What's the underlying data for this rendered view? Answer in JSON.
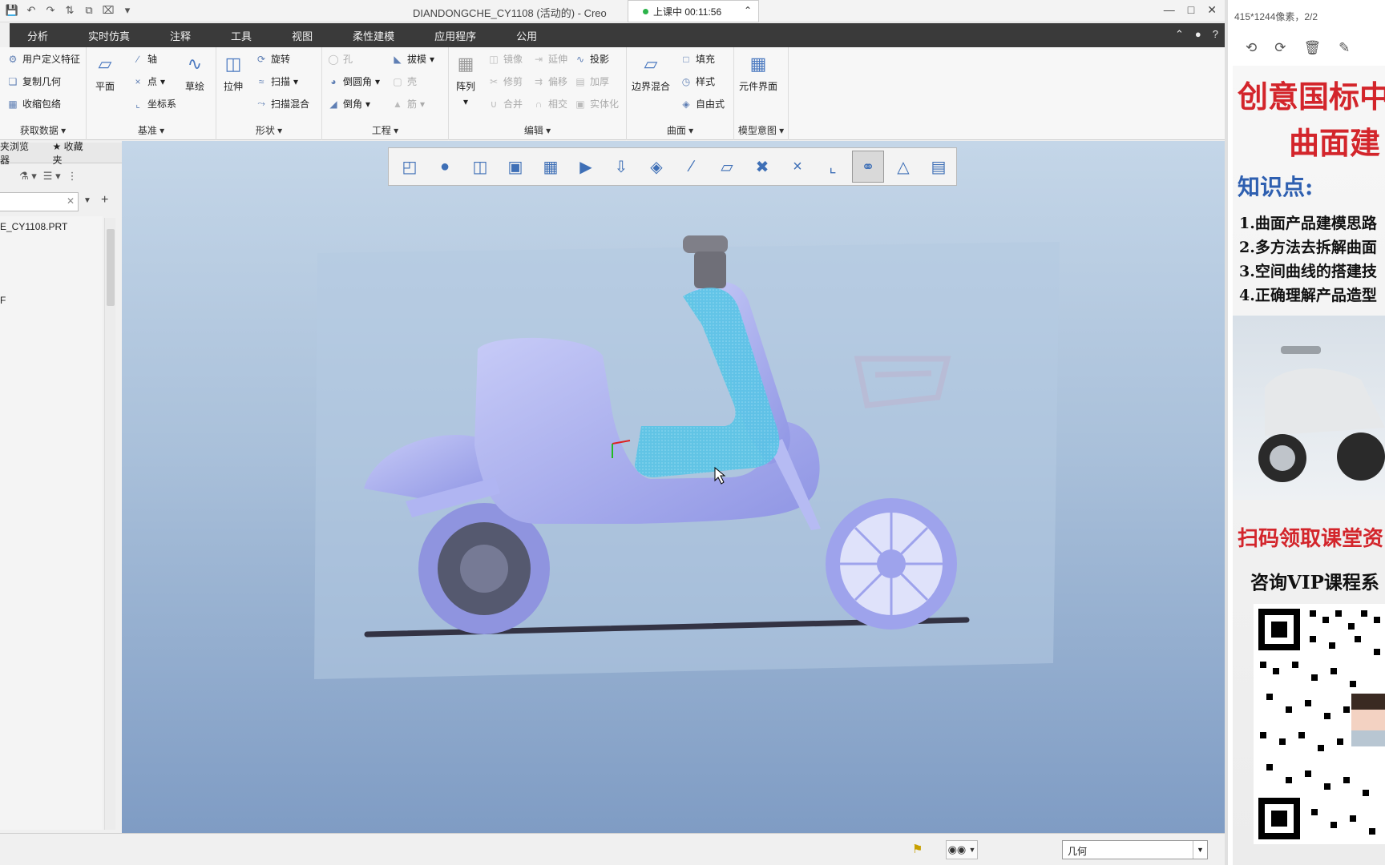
{
  "titlebar": {
    "title": "DIANDONGCHE_CY1108 (活动的) - Creo",
    "live_text": "上课中 00:11:56"
  },
  "menubar": {
    "tabs": [
      "分析",
      "实时仿真",
      "注释",
      "工具",
      "视图",
      "柔性建模",
      "应用程序",
      "公用"
    ]
  },
  "ribbon": {
    "get_data": {
      "label": "获取数据",
      "items": [
        "用户定义特征",
        "复制几何",
        "收缩包络"
      ]
    },
    "datum": {
      "label": "基准",
      "plane": "平面",
      "axis": "轴",
      "point": "点",
      "csys": "坐标系",
      "sketch": "草绘"
    },
    "shapes": {
      "label": "形状",
      "extrude": "拉伸",
      "revolve": "旋转",
      "sweep": "扫描",
      "swept_blend": "扫描混合"
    },
    "engineering": {
      "label": "工程",
      "hole": "孔",
      "round": "倒圆角",
      "chamfer": "倒角",
      "draft": "拔模",
      "shell": "壳",
      "rib": "筋"
    },
    "editing": {
      "label": "编辑",
      "pattern": "阵列",
      "mirror": "镜像",
      "trim": "修剪",
      "merge": "合并",
      "extend": "延伸",
      "offset": "偏移",
      "intersect": "相交",
      "project": "投影",
      "thicken": "加厚",
      "solidify": "实体化"
    },
    "surfaces": {
      "label": "曲面",
      "boundary_blend": "边界混合",
      "fill": "填充",
      "style": "样式",
      "freestyle": "自由式"
    },
    "model_intent": {
      "label": "模型意图",
      "component_interface": "元件界面"
    }
  },
  "left_panel": {
    "tabs": [
      "夹浏览器",
      "收藏夹"
    ],
    "tree": [
      "E_CY1108.PRT",
      "F"
    ]
  },
  "statusbar": {
    "filter_value": "几何"
  },
  "right_panel": {
    "title": "415*1244像素，2/2",
    "poster": {
      "title1": "创意国标中",
      "title2": "曲面建",
      "knowledge_label": "知识点:",
      "points": [
        "1.曲面产品建模思路",
        "2.多方法去拆解曲面",
        "3.空间曲线的搭建技",
        "4.正确理解产品造型"
      ],
      "scan_text": "扫码领取课堂资",
      "vip_text": "咨询VIP课程系"
    }
  },
  "colors": {
    "model": "#a7aef2",
    "selection": "#45c8e8",
    "menubar": "#3a3a3a"
  }
}
